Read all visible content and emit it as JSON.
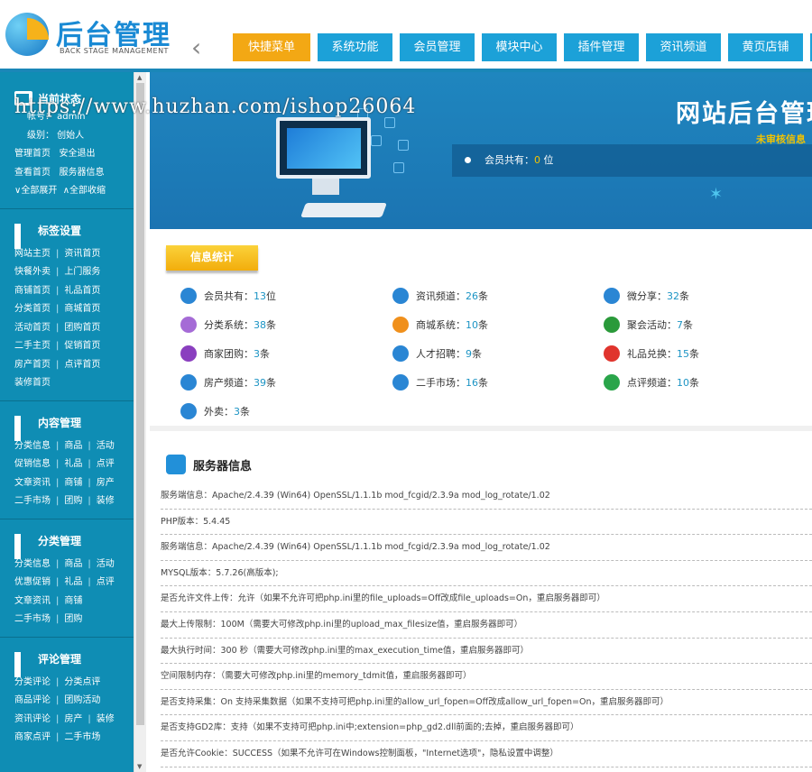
{
  "header": {
    "logo_title": "后台管理",
    "logo_sub": "BACK STAGE MANAGEMENT",
    "nav": [
      "快捷菜单",
      "系统功能",
      "会员管理",
      "模块中心",
      "插件管理",
      "资讯频道",
      "黄页店铺"
    ],
    "active_tab": 0
  },
  "watermark": "https://www.huzhan.com/ishop26064",
  "sidebar": {
    "status_title": "当前状态",
    "account_line": "帐号：  admin",
    "level_line": "级别：  创始人",
    "links1": [
      "管理首页",
      "安全退出"
    ],
    "links2": [
      "查看首页",
      "服务器信息"
    ],
    "links3": [
      "∨全部展开",
      "∧全部收缩"
    ],
    "tag_title": "标签设置",
    "tag_rows": [
      [
        "网站主页",
        "资讯首页"
      ],
      [
        "快餐外卖",
        "上门服务"
      ],
      [
        "商铺首页",
        "礼品首页"
      ],
      [
        "分类首页",
        "商城首页"
      ],
      [
        "活动首页",
        "团购首页"
      ],
      [
        "二手主页",
        "促销首页"
      ],
      [
        "房产首页",
        "点评首页"
      ],
      [
        "装修首页"
      ]
    ],
    "content_title": "内容管理",
    "content_rows": [
      [
        "分类信息",
        "商品",
        "活动"
      ],
      [
        "促销信息",
        "礼品",
        "点评"
      ],
      [
        "文章资讯",
        "商铺",
        "房产"
      ],
      [
        "二手市场",
        "团购",
        "装修"
      ]
    ],
    "class_title": "分类管理",
    "class_rows": [
      [
        "分类信息",
        "商品",
        "活动"
      ],
      [
        "优惠促销",
        "礼品",
        "点评"
      ],
      [
        "文章资讯",
        "商铺"
      ],
      [
        "二手市场",
        "团购"
      ]
    ],
    "review_title": "评论管理",
    "review_rows": [
      [
        "分类评论",
        "分类点评"
      ],
      [
        "商品评论",
        "团购活动"
      ],
      [
        "资讯评论",
        "房产",
        "装修"
      ],
      [
        "商家点评",
        "二手市场"
      ]
    ]
  },
  "banner": {
    "title": "网站后台管理",
    "unreviewed": "未审核信息",
    "member_text": "会员共有：",
    "member_count": "0",
    "member_unit": "位"
  },
  "stats": {
    "tag": "信息统计",
    "items": [
      {
        "label": "会员共有：",
        "value": "13",
        "unit": "位",
        "icon": "members-icon",
        "color": "#2a86d4"
      },
      {
        "label": "资讯频道：",
        "value": "26",
        "unit": "条",
        "icon": "news-icon",
        "color": "#2a86d4"
      },
      {
        "label": "微分享：",
        "value": "32",
        "unit": "条",
        "icon": "share-icon",
        "color": "#2a86d4"
      },
      {
        "label": "分类系统：",
        "value": "38",
        "unit": "条",
        "icon": "category-icon",
        "color": "#a56bd6"
      },
      {
        "label": "商城系统：",
        "value": "10",
        "unit": "条",
        "icon": "mall-icon",
        "color": "#f0901c"
      },
      {
        "label": "聚会活动：",
        "value": "7",
        "unit": "条",
        "icon": "party-icon",
        "color": "#2a9a3a"
      },
      {
        "label": "商家团购：",
        "value": "3",
        "unit": "条",
        "icon": "groupbuy-icon",
        "color": "#8a3fbf"
      },
      {
        "label": "人才招聘：",
        "value": "9",
        "unit": "条",
        "icon": "jobs-icon",
        "color": "#2a86d4"
      },
      {
        "label": "礼品兑换：",
        "value": "15",
        "unit": "条",
        "icon": "gift-icon",
        "color": "#e0342d"
      },
      {
        "label": "房产频道：",
        "value": "39",
        "unit": "条",
        "icon": "house-icon",
        "color": "#2a86d4"
      },
      {
        "label": "二手市场：",
        "value": "16",
        "unit": "条",
        "icon": "secondhand-icon",
        "color": "#2a86d4"
      },
      {
        "label": "点评频道：",
        "value": "10",
        "unit": "条",
        "icon": "review-icon",
        "color": "#2aa54a"
      },
      {
        "label": "外卖：",
        "value": "3",
        "unit": "条",
        "icon": "takeout-icon",
        "color": "#2a86d4"
      }
    ]
  },
  "server": {
    "title": "服务器信息",
    "rows": [
      "服务端信息：Apache/2.4.39 (Win64) OpenSSL/1.1.1b mod_fcgid/2.3.9a mod_log_rotate/1.02",
      "PHP版本：5.4.45",
      "服务端信息：Apache/2.4.39 (Win64) OpenSSL/1.1.1b mod_fcgid/2.3.9a mod_log_rotate/1.02",
      "MYSQL版本：5.7.26(高版本);",
      "是否允许文件上传：允许（如果不允许可把php.ini里的file_uploads=Off改成file_uploads=On，重启服务器即可）",
      "最大上传限制：100M（需要大可修改php.ini里的upload_max_filesize值，重启服务器即可）",
      "最大执行时间：300 秒（需要大可修改php.ini里的max_execution_time值，重启服务器即可）",
      "空间限制内存：（需要大可修改php.ini里的memory_tdmit值，重启服务器即可）",
      "是否支持采集：On 支持采集数据（如果不支持可把php.ini里的allow_url_fopen=Off改成allow_url_fopen=On，重启服务器即可）",
      "是否支持GD2库：支持（如果不支持可把php.ini中;extension=php_gd2.dll前面的;去掉，重启服务器即可）",
      "是否允许Cookie：SUCCESS（如果不允许可在Windows控制面板，\"Internet选项\"，隐私设置中调整）"
    ]
  }
}
